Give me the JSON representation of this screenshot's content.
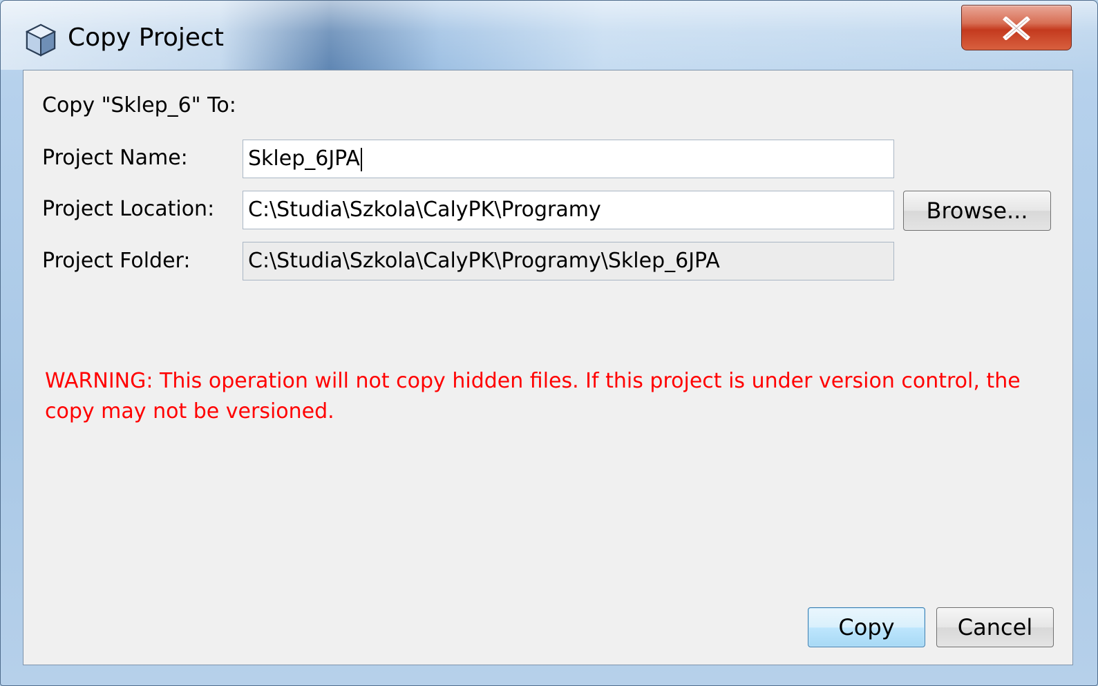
{
  "window": {
    "title": "Copy Project",
    "close_icon": "close-icon"
  },
  "dialog": {
    "heading": "Copy \"Sklep_6\" To:",
    "project_name": {
      "label": "Project Name:",
      "value": "Sklep_6JPA"
    },
    "project_location": {
      "label": "Project Location:",
      "value": "C:\\Studia\\Szkola\\CalyPK\\Programy"
    },
    "project_folder": {
      "label": "Project Folder:",
      "value": "C:\\Studia\\Szkola\\CalyPK\\Programy\\Sklep_6JPA"
    },
    "browse_label": "Browse...",
    "warning": "WARNING: This operation will not copy hidden files. If this project is under version control, the copy may not be versioned."
  },
  "buttons": {
    "copy": "Copy",
    "cancel": "Cancel"
  },
  "colors": {
    "warning": "#ff0000",
    "client_background": "#f0f0f0"
  }
}
